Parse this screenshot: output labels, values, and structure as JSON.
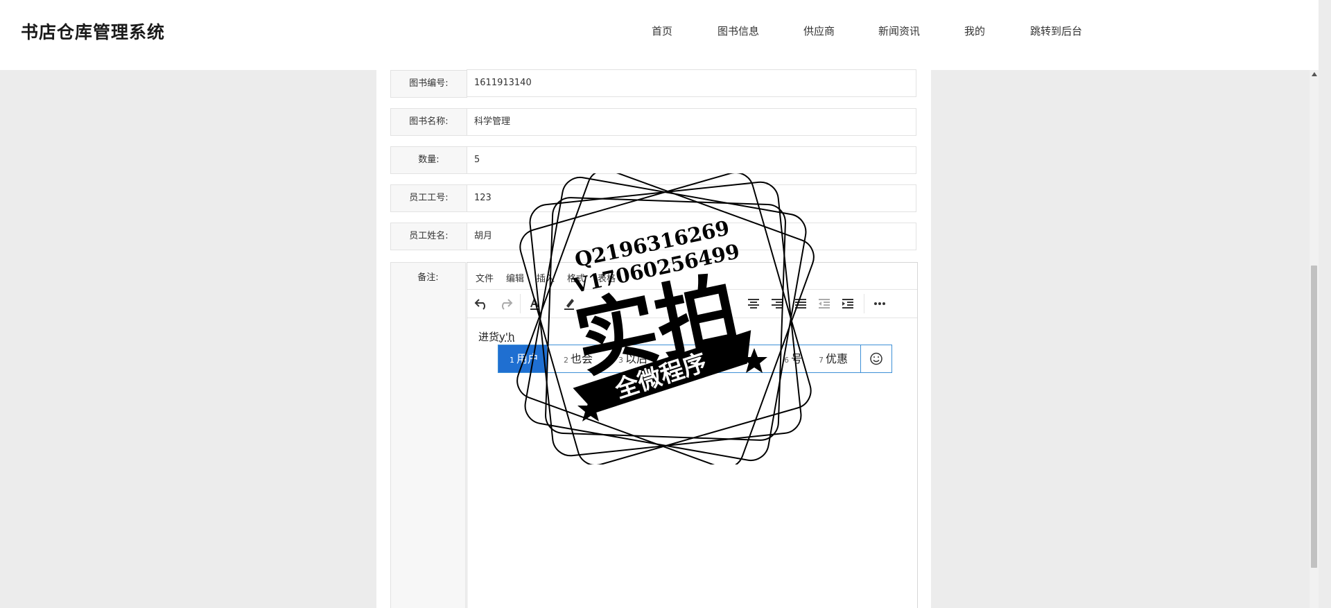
{
  "header": {
    "title": "书店仓库管理系统",
    "nav": [
      {
        "label": "首页"
      },
      {
        "label": "图书信息"
      },
      {
        "label": "供应商"
      },
      {
        "label": "新闻资讯"
      },
      {
        "label": "我的"
      },
      {
        "label": "跳转到后台"
      }
    ]
  },
  "form": {
    "fields": [
      {
        "label": "图书编号:",
        "value": "1611913140"
      },
      {
        "label": "图书名称:",
        "value": "科学管理"
      },
      {
        "label": "数量:",
        "value": "5"
      },
      {
        "label": "员工工号:",
        "value": "123"
      },
      {
        "label": "员工姓名:",
        "value": "胡月"
      }
    ],
    "remark_label": "备注:"
  },
  "editor": {
    "menu": [
      "文件",
      "编辑",
      "插入",
      "格式",
      "表格"
    ],
    "content_text": "进货",
    "composition_text": "y'h",
    "toolbar_icons": [
      "undo-icon",
      "redo-icon",
      "font-color-icon",
      "highlight-icon",
      "align-center-icon",
      "align-right-icon",
      "align-justify-icon",
      "outdent-icon",
      "indent-icon",
      "more-icon"
    ]
  },
  "ime": {
    "candidates": [
      {
        "num": "1",
        "text": "用户",
        "active": true
      },
      {
        "num": "2",
        "text": "也会"
      },
      {
        "num": "3",
        "text": "以后"
      },
      {
        "num": "4",
        "text": "银行"
      },
      {
        "num": "6",
        "text": "号"
      },
      {
        "num": "7",
        "text": "优惠"
      }
    ]
  },
  "watermark": {
    "contact_q": "Q2196316269",
    "contact_v": "V17060256499",
    "main": "实拍",
    "banner": "全微程序"
  },
  "colors": {
    "accent": "#1f6fd1",
    "ime_border": "#3d8fd6",
    "background": "#ececec"
  }
}
